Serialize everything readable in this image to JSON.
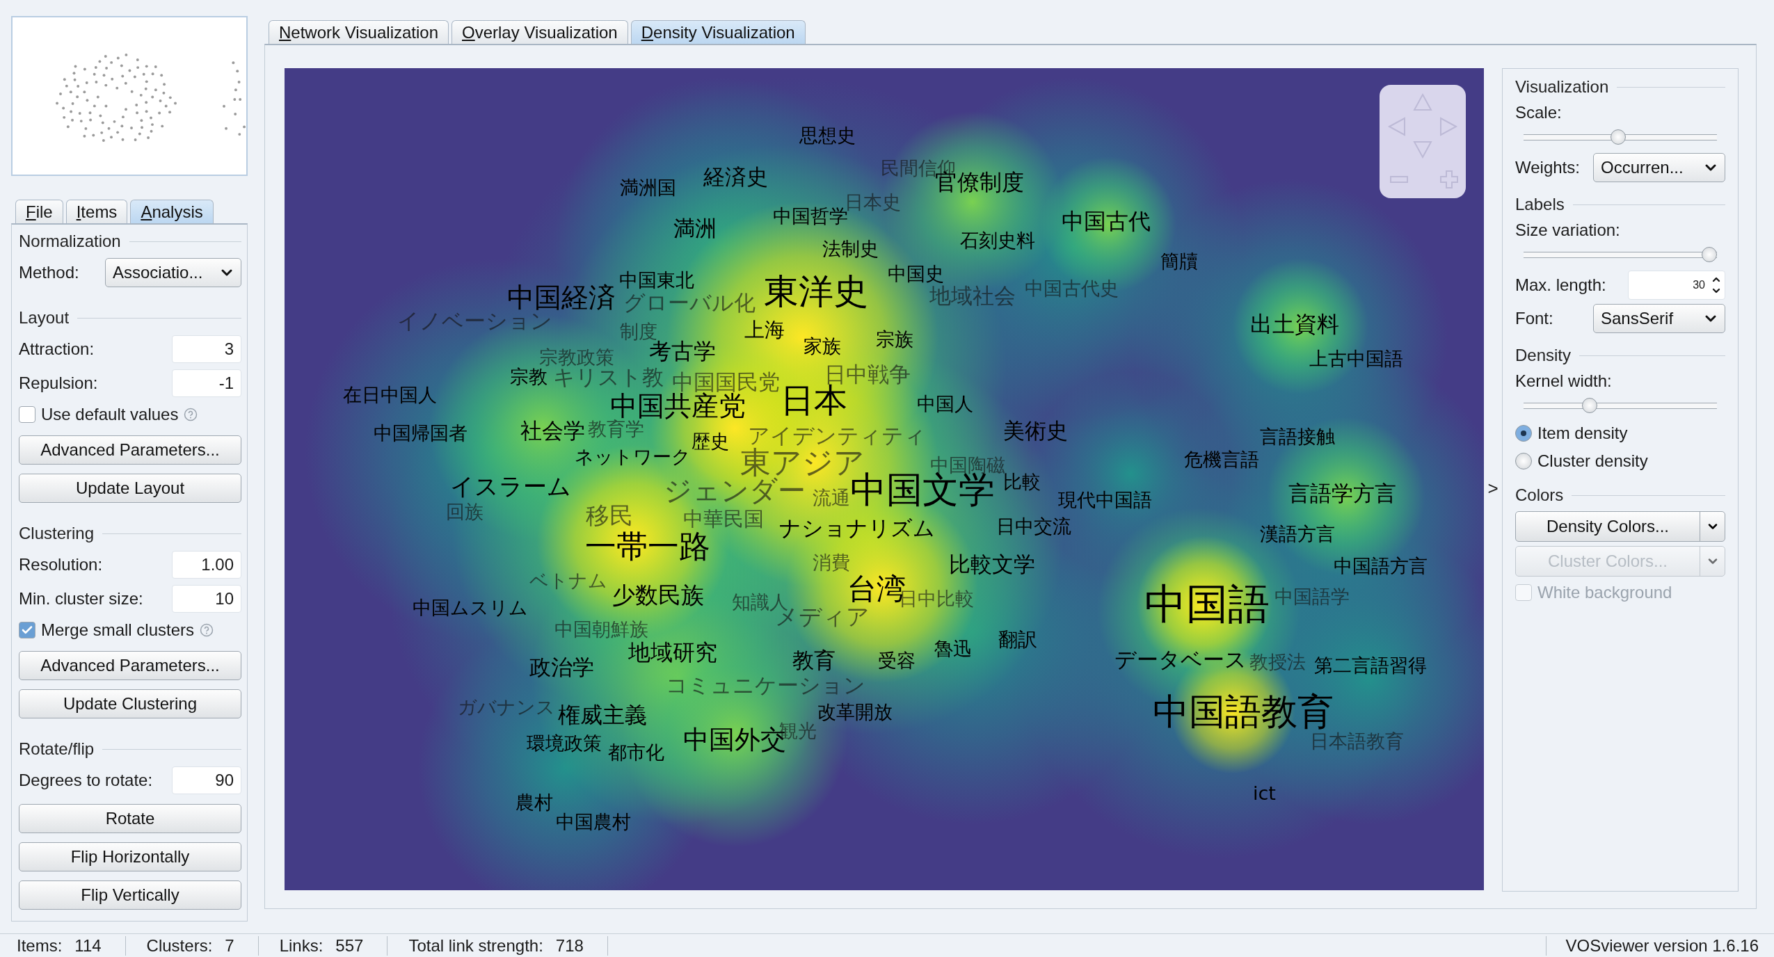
{
  "side_tabs": [
    {
      "label": "File",
      "selected": false
    },
    {
      "label": "Items",
      "selected": false
    },
    {
      "label": "Analysis",
      "selected": true
    }
  ],
  "analysis_panel": [
    {
      "title": "Normalization",
      "select": {
        "label": "Method:",
        "value": "Associatio..."
      }
    },
    {
      "title": "Layout",
      "fields": [
        {
          "label": "Attraction:",
          "value": "3"
        },
        {
          "label": "Repulsion:",
          "value": "-1"
        }
      ],
      "checkbox": {
        "label": "Use default values",
        "checked": false
      },
      "buttons": [
        "Advanced Parameters...",
        "Update Layout"
      ]
    },
    {
      "title": "Clustering",
      "fields": [
        {
          "label": "Resolution:",
          "value": "1.00"
        },
        {
          "label": "Min. cluster size:",
          "value": "10"
        }
      ],
      "checkbox": {
        "label": "Merge small clusters",
        "checked": true
      },
      "buttons": [
        "Advanced Parameters...",
        "Update Clustering"
      ]
    },
    {
      "title": "Rotate/flip",
      "fields": [
        {
          "label": "Degrees to rotate:",
          "value": "90"
        }
      ],
      "buttons": [
        "Rotate",
        "Flip Horizontally",
        "Flip Vertically"
      ]
    }
  ],
  "view_tabs": [
    {
      "label": "Network Visualization",
      "selected": false
    },
    {
      "label": "Overlay Visualization",
      "selected": false
    },
    {
      "label": "Density Visualization",
      "selected": true
    }
  ],
  "map": {
    "labels": [
      {
        "text": "思想史",
        "faded": false
      },
      {
        "text": "満洲国",
        "faded": false
      },
      {
        "text": "経済史",
        "faded": false
      },
      {
        "text": "民間信仰",
        "faded": true
      },
      {
        "text": "官僚制度",
        "faded": false
      },
      {
        "text": "日本史",
        "faded": true
      },
      {
        "text": "満洲",
        "faded": false
      },
      {
        "text": "中国哲学",
        "faded": false
      },
      {
        "text": "中国古代",
        "faded": false
      },
      {
        "text": "法制史",
        "faded": false
      },
      {
        "text": "石刻史料",
        "faded": false
      },
      {
        "text": "中国史",
        "faded": false
      },
      {
        "text": "簡牘",
        "faded": false
      },
      {
        "text": "中国経済",
        "faded": false
      },
      {
        "text": "中国東北",
        "faded": false
      },
      {
        "text": "グローバル化",
        "faded": true
      },
      {
        "text": "東洋史",
        "faded": false
      },
      {
        "text": "地域社会",
        "faded": true
      },
      {
        "text": "中国古代史",
        "faded": true
      },
      {
        "text": "イノベーション",
        "faded": true
      },
      {
        "text": "制度",
        "faded": true
      },
      {
        "text": "上海",
        "faded": false
      },
      {
        "text": "家族",
        "faded": false
      },
      {
        "text": "宗族",
        "faded": false
      },
      {
        "text": "出土資料",
        "faded": false
      },
      {
        "text": "宗教政策",
        "faded": true
      },
      {
        "text": "考古学",
        "faded": false
      },
      {
        "text": "上古中国語",
        "faded": false
      },
      {
        "text": "宗教",
        "faded": false
      },
      {
        "text": "キリスト教",
        "faded": true
      },
      {
        "text": "中国国民党",
        "faded": true
      },
      {
        "text": "日中戦争",
        "faded": true
      },
      {
        "text": "在日中国人",
        "faded": false
      },
      {
        "text": "中国共産党",
        "faded": false
      },
      {
        "text": "日本",
        "faded": false
      },
      {
        "text": "中国人",
        "faded": false
      },
      {
        "text": "中国帰国者",
        "faded": false
      },
      {
        "text": "社会学",
        "faded": false
      },
      {
        "text": "教育学",
        "faded": true
      },
      {
        "text": "歴史",
        "faded": false
      },
      {
        "text": "アイデンティティ",
        "faded": true
      },
      {
        "text": "美術史",
        "faded": false
      },
      {
        "text": "言語接触",
        "faded": false
      },
      {
        "text": "ネットワーク",
        "faded": false
      },
      {
        "text": "東アジア",
        "faded": true
      },
      {
        "text": "中国陶磁",
        "faded": true
      },
      {
        "text": "危機言語",
        "faded": false
      },
      {
        "text": "イスラーム",
        "faded": false
      },
      {
        "text": "ジェンダー",
        "faded": true
      },
      {
        "text": "流通",
        "faded": true
      },
      {
        "text": "中国文学",
        "faded": false
      },
      {
        "text": "比較",
        "faded": false
      },
      {
        "text": "現代中国語",
        "faded": false
      },
      {
        "text": "言語学方言",
        "faded": false
      },
      {
        "text": "回族",
        "faded": true
      },
      {
        "text": "移民",
        "faded": true
      },
      {
        "text": "一帯一路",
        "faded": false
      },
      {
        "text": "中華民国",
        "faded": true
      },
      {
        "text": "ナショナリズム",
        "faded": false
      },
      {
        "text": "日中交流",
        "faded": false
      },
      {
        "text": "漢語方言",
        "faded": false
      },
      {
        "text": "消費",
        "faded": true
      },
      {
        "text": "比較文学",
        "faded": false
      },
      {
        "text": "中国語方言",
        "faded": false
      },
      {
        "text": "中国ムスリム",
        "faded": false
      },
      {
        "text": "ベトナム",
        "faded": true
      },
      {
        "text": "少数民族",
        "faded": false
      },
      {
        "text": "知識人",
        "faded": true
      },
      {
        "text": "台湾",
        "faded": false
      },
      {
        "text": "日中比較",
        "faded": true
      },
      {
        "text": "中国語",
        "faded": false
      },
      {
        "text": "中国語学",
        "faded": true
      },
      {
        "text": "中国朝鮮族",
        "faded": true
      },
      {
        "text": "地域研究",
        "faded": false
      },
      {
        "text": "メディア",
        "faded": true
      },
      {
        "text": "魯迅",
        "faded": false
      },
      {
        "text": "翻訳",
        "faded": false
      },
      {
        "text": "政治学",
        "faded": false
      },
      {
        "text": "教育",
        "faded": false
      },
      {
        "text": "受容",
        "faded": false
      },
      {
        "text": "データベース",
        "faded": false
      },
      {
        "text": "教授法",
        "faded": true
      },
      {
        "text": "第二言語習得",
        "faded": false
      },
      {
        "text": "コミュニケーション",
        "faded": true
      },
      {
        "text": "ガバナンス",
        "faded": true
      },
      {
        "text": "権威主義",
        "faded": false
      },
      {
        "text": "改革開放",
        "faded": false
      },
      {
        "text": "中国語教育",
        "faded": false
      },
      {
        "text": "環境政策",
        "faded": false
      },
      {
        "text": "都市化",
        "faded": false
      },
      {
        "text": "中国外交",
        "faded": false
      },
      {
        "text": "観光",
        "faded": true
      },
      {
        "text": "日本語教育",
        "faded": true
      },
      {
        "text": "農村",
        "faded": false
      },
      {
        "text": "ict",
        "faded": false
      },
      {
        "text": "中国農村",
        "faded": false
      }
    ]
  },
  "panel_toggle": ">",
  "options_panel": {
    "visualization": {
      "title": "Visualization",
      "scale": {
        "label": "Scale:",
        "level": 0.49
      },
      "weights": {
        "label": "Weights:",
        "value": "Occurren..."
      }
    },
    "labels": {
      "title": "Labels",
      "size_variation": {
        "label": "Size variation:",
        "level": 1
      },
      "max_length": {
        "label": "Max. length:",
        "value": "30"
      },
      "font": {
        "label": "Font:",
        "value": "SansSerif"
      }
    },
    "density": {
      "title": "Density",
      "kernel_width": {
        "label": "Kernel width:",
        "level": 0.33
      },
      "options": [
        {
          "label": "Item density",
          "selected": true
        },
        {
          "label": "Cluster density",
          "selected": false
        }
      ]
    },
    "colors": {
      "title": "Colors",
      "buttons": [
        {
          "label": "Density Colors...",
          "disabled": false
        },
        {
          "label": "Cluster Colors...",
          "disabled": true
        }
      ],
      "checkbox": {
        "label": "White background",
        "checked": false,
        "disabled": true
      }
    }
  },
  "status_bar": {
    "items": [
      {
        "label": "Items:",
        "value": "114"
      },
      {
        "label": "Clusters:",
        "value": "7"
      },
      {
        "label": "Links:",
        "value": "557"
      },
      {
        "label": "Total link strength:",
        "value": "718"
      }
    ],
    "version": "VOSviewer version 1.6.16"
  }
}
